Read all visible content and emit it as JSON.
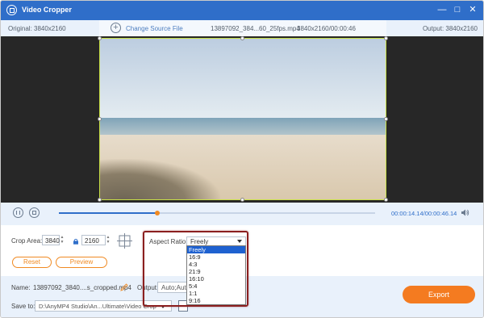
{
  "window": {
    "title": "Video Cropper",
    "icons": [
      "app-logo-icon",
      "minimize-icon",
      "maximize-icon",
      "close-icon"
    ]
  },
  "info_bar": {
    "original": "Original: 3840x2160",
    "change_source": "Change Source File",
    "file_name": "13897092_384...60_25fps.mp4",
    "file_res_time": "3840x2160/00:00:46",
    "output": "Output: 3840x2160"
  },
  "player": {
    "time": "00:00:14.14/00:00:46.14",
    "progress": 0.31
  },
  "crop": {
    "crop_area_label": "Crop Area:",
    "width": "3840",
    "height": "2160",
    "aspect_label": "Aspect Ratio:",
    "aspect_value": "Freely",
    "reset": "Reset",
    "preview": "Preview",
    "options": [
      "Freely",
      "16:9",
      "4:3",
      "21:9",
      "16:10",
      "5:4",
      "1:1",
      "9:16"
    ],
    "selected_index": 0
  },
  "bottom": {
    "name_label": "Name:",
    "name_value": "13897092_3840....s_cropped.mp4",
    "output_label": "Output:",
    "output_value": "Auto;Auto",
    "save_label": "Save to:",
    "save_path": "D:\\AnyMP4 Studio\\An...Ultimate\\Video Crop",
    "export": "Export"
  },
  "colors": {
    "titlebar": "#2f6ec9",
    "accent": "#f08a22",
    "export": "#f47b20",
    "crop_border": "#c9e046",
    "highlight": "#8b1f1f"
  }
}
